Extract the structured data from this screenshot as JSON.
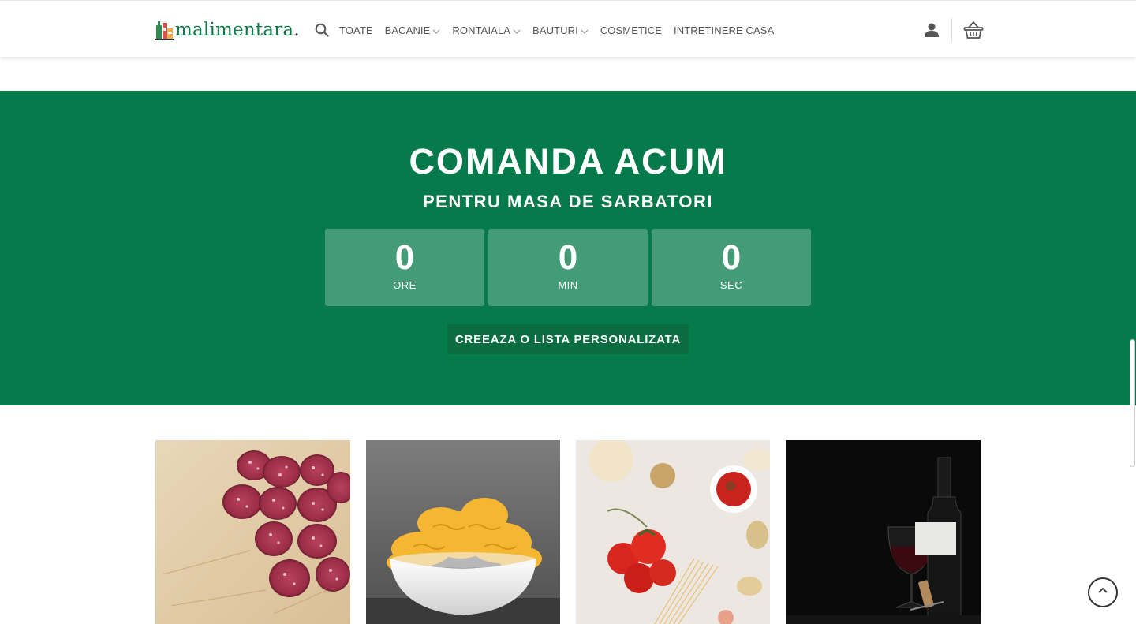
{
  "header": {
    "logo_text": "malimentara",
    "logo_dot": ".",
    "nav": [
      {
        "label": "TOATE",
        "dropdown": false
      },
      {
        "label": "BACANIE",
        "dropdown": true
      },
      {
        "label": "RONTAIALA",
        "dropdown": true
      },
      {
        "label": "BAUTURI",
        "dropdown": true
      },
      {
        "label": "COSMETICE",
        "dropdown": false
      },
      {
        "label": "INTRETINERE CASA",
        "dropdown": false
      }
    ]
  },
  "banner": {
    "title": "COMANDA ACUM",
    "subtitle": "PENTRU MASA DE SARBATORI",
    "countdown": [
      {
        "value": "0",
        "label": "ORE"
      },
      {
        "value": "0",
        "label": "MIN"
      },
      {
        "value": "0",
        "label": "SEC"
      }
    ],
    "cta_label": "CREEAZA O LISTA PERSONALIZATA"
  },
  "tiles": [
    {
      "image": "salami-slices"
    },
    {
      "image": "chips-bowl"
    },
    {
      "image": "tomatoes-pasta"
    },
    {
      "image": "red-wine-bottle"
    }
  ],
  "colors": {
    "brand_green": "#067a4b",
    "cta_green": "#0a6d41"
  },
  "icons": [
    "search-icon",
    "chevron-down-icon",
    "user-icon",
    "basket-icon",
    "arrow-up-icon"
  ]
}
